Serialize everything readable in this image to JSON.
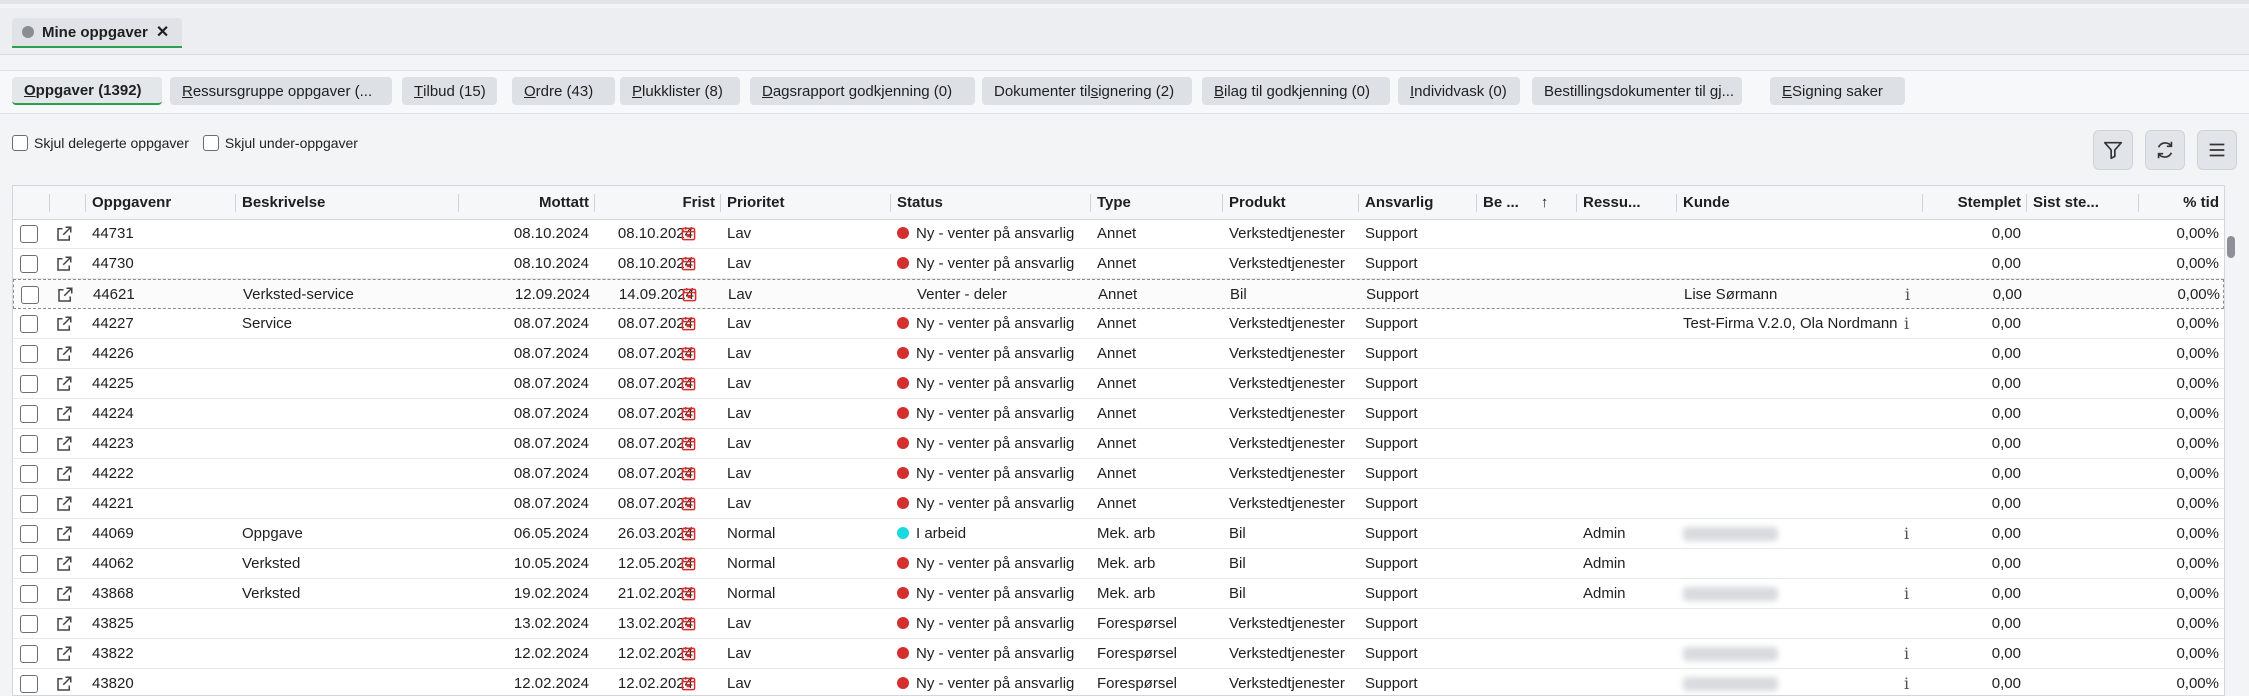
{
  "window_tab": {
    "label": "Mine oppgaver",
    "close": "✕"
  },
  "subtabs": [
    {
      "pre": "",
      "u": "O",
      "rest": "ppgaver (1392)",
      "active": true
    },
    {
      "pre": "",
      "u": "R",
      "rest": "essursgruppe oppgaver (...",
      "active": false
    },
    {
      "pre": "",
      "u": "T",
      "rest": "ilbud (15)",
      "active": false
    },
    {
      "pre": "",
      "u": "O",
      "rest": "rdre (43)",
      "active": false
    },
    {
      "pre": "",
      "u": "P",
      "rest": "lukklister (8)",
      "active": false
    },
    {
      "pre": "",
      "u": "D",
      "rest": "agsrapport godkjenning (0)",
      "active": false
    },
    {
      "pre": "Dokumenter til ",
      "u": "s",
      "rest": "ignering (2)",
      "active": false
    },
    {
      "pre": "",
      "u": "B",
      "rest": "ilag til godkjenning (0)",
      "active": false
    },
    {
      "pre": "",
      "u": "I",
      "rest": "ndividvask (0)",
      "active": false
    },
    {
      "pre": "Bestillingsdokumenter til gj...",
      "u": "",
      "rest": "",
      "active": false
    },
    {
      "pre": "",
      "u": "E",
      "rest": "Signing saker",
      "active": false
    }
  ],
  "filters": {
    "hide_delegated": "Skjul delegerte oppgaver",
    "hide_sub": "Skjul under-oppgaver"
  },
  "toolbar": {
    "filter_icon": "filter-icon",
    "refresh_icon": "refresh-icon",
    "menu_icon": "menu-icon"
  },
  "columns": {
    "oppgavenr": "Oppgavenr",
    "beskrivelse": "Beskrivelse",
    "mottatt": "Mottatt",
    "frist": "Frist",
    "prioritet": "Prioritet",
    "status": "Status",
    "type": "Type",
    "produkt": "Produkt",
    "ansvarlig": "Ansvarlig",
    "be": "Be ...",
    "ressu": "Ressu...",
    "kunde": "Kunde",
    "stemplet": "Stemplet",
    "sist": "Sist ste...",
    "tid": "% tid",
    "sort_arrow": "↑"
  },
  "colors": {
    "red": "#d32f2f",
    "cyan": "#1ad8e0",
    "green": "#2e9e4f"
  },
  "rows": [
    {
      "nr": "44731",
      "besk": "",
      "mottatt": "08.10.2024",
      "frist": "08.10.2024",
      "prio": "Lav",
      "status": "Ny - venter på ansvarlig",
      "dot": "red",
      "type": "Annet",
      "produkt": "Verkstedtjenester",
      "ansv": "Support",
      "ress": "",
      "kunde": "",
      "info": false,
      "blur": false,
      "stemplet": "0,00",
      "tid": "0,00%"
    },
    {
      "nr": "44730",
      "besk": "",
      "mottatt": "08.10.2024",
      "frist": "08.10.2024",
      "prio": "Lav",
      "status": "Ny - venter på ansvarlig",
      "dot": "red",
      "type": "Annet",
      "produkt": "Verkstedtjenester",
      "ansv": "Support",
      "ress": "",
      "kunde": "",
      "info": false,
      "blur": false,
      "stemplet": "0,00",
      "tid": "0,00%"
    },
    {
      "nr": "44621",
      "besk": "Verksted-service",
      "mottatt": "12.09.2024",
      "frist": "14.09.2024",
      "prio": "Lav",
      "status": "Venter - deler",
      "dot": "",
      "type": "Annet",
      "produkt": "Bil",
      "ansv": "Support",
      "ress": "",
      "kunde": "Lise Sørmann",
      "info": true,
      "blur": false,
      "stemplet": "0,00",
      "tid": "0,00%",
      "sel": true
    },
    {
      "nr": "44227",
      "besk": "Service",
      "mottatt": "08.07.2024",
      "frist": "08.07.2024",
      "prio": "Lav",
      "status": "Ny - venter på ansvarlig",
      "dot": "red",
      "type": "Annet",
      "produkt": "Verkstedtjenester",
      "ansv": "Support",
      "ress": "",
      "kunde": "Test-Firma V.2.0, Ola Nordmann",
      "info": true,
      "blur": false,
      "stemplet": "0,00",
      "tid": "0,00%"
    },
    {
      "nr": "44226",
      "besk": "",
      "mottatt": "08.07.2024",
      "frist": "08.07.2024",
      "prio": "Lav",
      "status": "Ny - venter på ansvarlig",
      "dot": "red",
      "type": "Annet",
      "produkt": "Verkstedtjenester",
      "ansv": "Support",
      "ress": "",
      "kunde": "",
      "info": false,
      "blur": false,
      "stemplet": "0,00",
      "tid": "0,00%"
    },
    {
      "nr": "44225",
      "besk": "",
      "mottatt": "08.07.2024",
      "frist": "08.07.2024",
      "prio": "Lav",
      "status": "Ny - venter på ansvarlig",
      "dot": "red",
      "type": "Annet",
      "produkt": "Verkstedtjenester",
      "ansv": "Support",
      "ress": "",
      "kunde": "",
      "info": false,
      "blur": false,
      "stemplet": "0,00",
      "tid": "0,00%"
    },
    {
      "nr": "44224",
      "besk": "",
      "mottatt": "08.07.2024",
      "frist": "08.07.2024",
      "prio": "Lav",
      "status": "Ny - venter på ansvarlig",
      "dot": "red",
      "type": "Annet",
      "produkt": "Verkstedtjenester",
      "ansv": "Support",
      "ress": "",
      "kunde": "",
      "info": false,
      "blur": false,
      "stemplet": "0,00",
      "tid": "0,00%"
    },
    {
      "nr": "44223",
      "besk": "",
      "mottatt": "08.07.2024",
      "frist": "08.07.2024",
      "prio": "Lav",
      "status": "Ny - venter på ansvarlig",
      "dot": "red",
      "type": "Annet",
      "produkt": "Verkstedtjenester",
      "ansv": "Support",
      "ress": "",
      "kunde": "",
      "info": false,
      "blur": false,
      "stemplet": "0,00",
      "tid": "0,00%"
    },
    {
      "nr": "44222",
      "besk": "",
      "mottatt": "08.07.2024",
      "frist": "08.07.2024",
      "prio": "Lav",
      "status": "Ny - venter på ansvarlig",
      "dot": "red",
      "type": "Annet",
      "produkt": "Verkstedtjenester",
      "ansv": "Support",
      "ress": "",
      "kunde": "",
      "info": false,
      "blur": false,
      "stemplet": "0,00",
      "tid": "0,00%"
    },
    {
      "nr": "44221",
      "besk": "",
      "mottatt": "08.07.2024",
      "frist": "08.07.2024",
      "prio": "Lav",
      "status": "Ny - venter på ansvarlig",
      "dot": "red",
      "type": "Annet",
      "produkt": "Verkstedtjenester",
      "ansv": "Support",
      "ress": "",
      "kunde": "",
      "info": false,
      "blur": false,
      "stemplet": "0,00",
      "tid": "0,00%"
    },
    {
      "nr": "44069",
      "besk": "Oppgave",
      "mottatt": "06.05.2024",
      "frist": "26.03.2024",
      "prio": "Normal",
      "status": "I arbeid",
      "dot": "cyan",
      "type": "Mek. arb",
      "produkt": "Bil",
      "ansv": "Support",
      "ress": "Admin",
      "kunde": "",
      "info": true,
      "blur": true,
      "stemplet": "0,00",
      "tid": "0,00%"
    },
    {
      "nr": "44062",
      "besk": "Verksted",
      "mottatt": "10.05.2024",
      "frist": "12.05.2024",
      "prio": "Normal",
      "status": "Ny - venter på ansvarlig",
      "dot": "red",
      "type": "Mek. arb",
      "produkt": "Bil",
      "ansv": "Support",
      "ress": "Admin",
      "kunde": "",
      "info": false,
      "blur": false,
      "stemplet": "0,00",
      "tid": "0,00%"
    },
    {
      "nr": "43868",
      "besk": "Verksted",
      "mottatt": "19.02.2024",
      "frist": "21.02.2024",
      "prio": "Normal",
      "status": "Ny - venter på ansvarlig",
      "dot": "red",
      "type": "Mek. arb",
      "produkt": "Bil",
      "ansv": "Support",
      "ress": "Admin",
      "kunde": "",
      "info": true,
      "blur": true,
      "stemplet": "0,00",
      "tid": "0,00%"
    },
    {
      "nr": "43825",
      "besk": "",
      "mottatt": "13.02.2024",
      "frist": "13.02.2024",
      "prio": "Lav",
      "status": "Ny - venter på ansvarlig",
      "dot": "red",
      "type": "Forespørsel",
      "produkt": "Verkstedtjenester",
      "ansv": "Support",
      "ress": "",
      "kunde": "",
      "info": false,
      "blur": false,
      "stemplet": "0,00",
      "tid": "0,00%"
    },
    {
      "nr": "43822",
      "besk": "",
      "mottatt": "12.02.2024",
      "frist": "12.02.2024",
      "prio": "Lav",
      "status": "Ny - venter på ansvarlig",
      "dot": "red",
      "type": "Forespørsel",
      "produkt": "Verkstedtjenester",
      "ansv": "Support",
      "ress": "",
      "kunde": "",
      "info": true,
      "blur": true,
      "stemplet": "0,00",
      "tid": "0,00%"
    },
    {
      "nr": "43820",
      "besk": "",
      "mottatt": "12.02.2024",
      "frist": "12.02.2024",
      "prio": "Lav",
      "status": "Ny - venter på ansvarlig",
      "dot": "red",
      "type": "Forespørsel",
      "produkt": "Verkstedtjenester",
      "ansv": "Support",
      "ress": "",
      "kunde": "",
      "info": true,
      "blur": true,
      "stemplet": "0,00",
      "tid": "0,00%"
    }
  ]
}
